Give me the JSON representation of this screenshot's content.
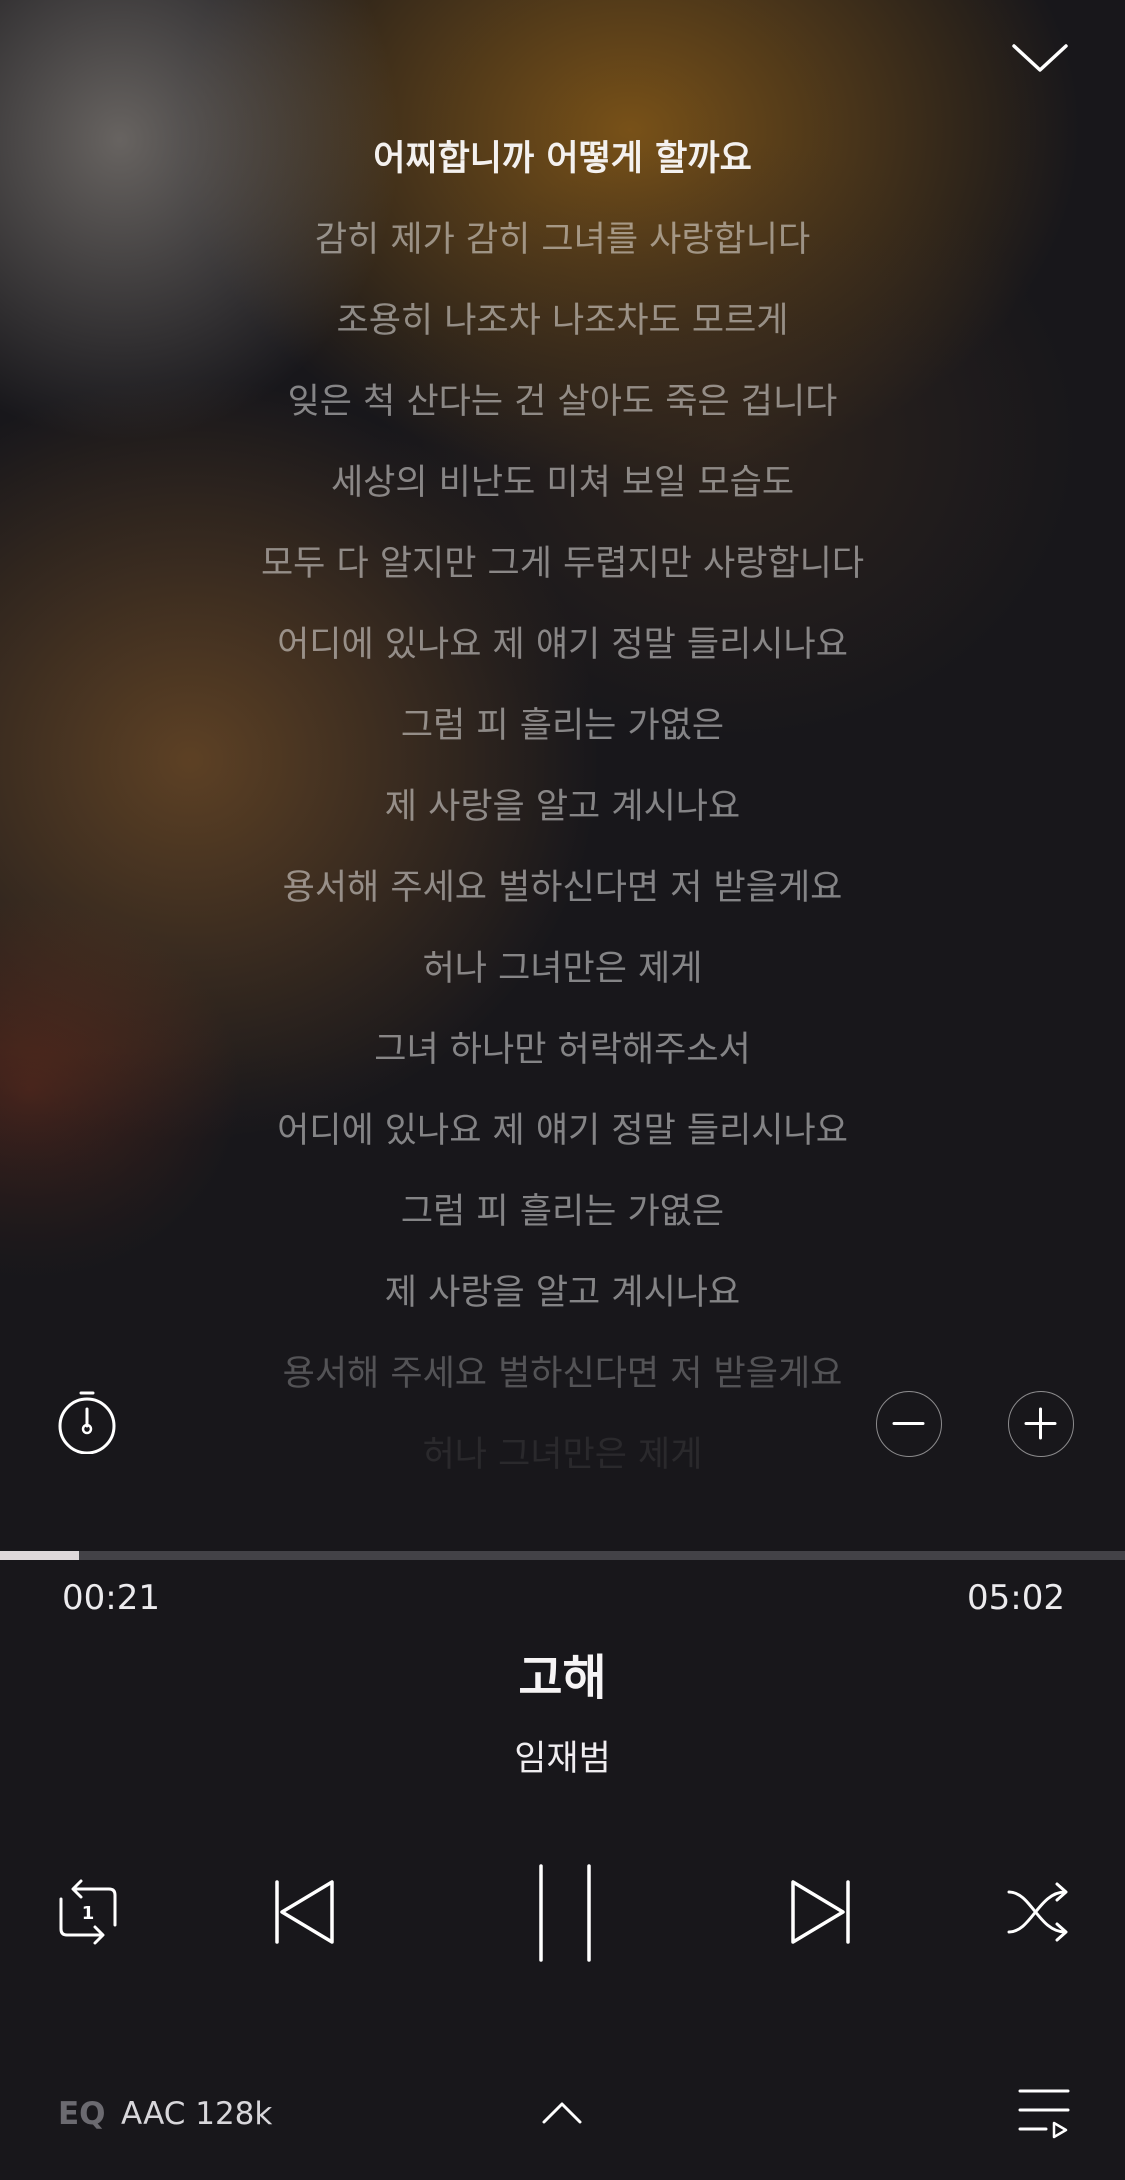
{
  "player": {
    "lyrics": [
      "어찌합니까 어떻게 할까요",
      "감히 제가 감히 그녀를 사랑합니다",
      "조용히 나조차 나조차도 모르게",
      "잊은 척 산다는 건 살아도 죽은 겁니다",
      "세상의 비난도 미쳐 보일 모습도",
      "모두 다 알지만 그게 두렵지만 사랑합니다",
      "어디에 있나요 제 얘기 정말 들리시나요",
      "그럼 피 흘리는 가엾은",
      "제 사랑을 알고 계시나요",
      "용서해 주세요 벌하신다면 저 받을게요",
      "허나 그녀만은 제게",
      "그녀 하나만 허락해주소서",
      "어디에 있나요 제 얘기 정말 들리시나요",
      "그럼 피 흘리는 가엾은",
      "제 사랑을 알고 계시나요",
      "용서해 주세요 벌하신다면 저 받을게요",
      "허나 그녀만은 제게"
    ],
    "current_line_index": 0,
    "progress_fraction": 0.07,
    "elapsed": "00:21",
    "duration": "05:02",
    "song_title": "고해",
    "artist": "임재범",
    "eq_label": "EQ",
    "codec": "AAC 128k",
    "repeat_badge": "1",
    "colors": {
      "background": "#18171b",
      "progress_fill": "#ded8da",
      "progress_track": "#434247",
      "accent_blur": "#7d5418"
    }
  }
}
